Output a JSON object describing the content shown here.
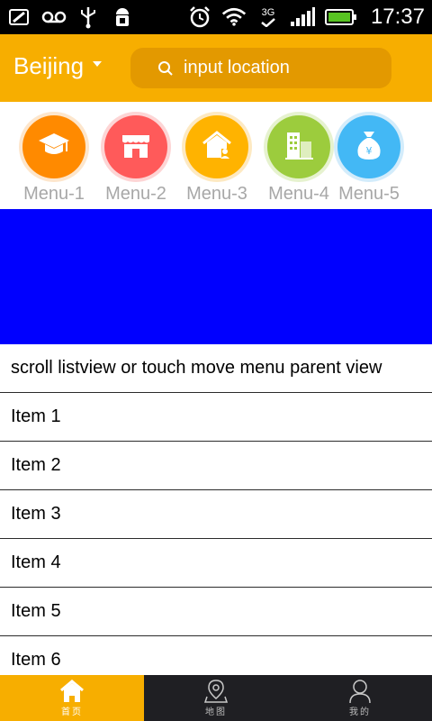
{
  "status_bar": {
    "time": "17:37",
    "network_label": "3G",
    "icons": [
      "sim-card-icon",
      "voicemail-icon",
      "usb-icon",
      "android-icon",
      "alarm-icon",
      "wifi-icon",
      "network-3g-icon",
      "signal-bars-icon",
      "battery-icon"
    ]
  },
  "header": {
    "city": "Beijing",
    "search_placeholder": "input location",
    "colors": {
      "bar": "#f7ae00",
      "search_bg": "#e39900"
    }
  },
  "menu": {
    "items": [
      {
        "label": "Menu-1",
        "icon": "graduation-cap-icon",
        "color": "#ff8a00",
        "ring": "#fde6cc"
      },
      {
        "label": "Menu-2",
        "icon": "shop-icon",
        "color": "#ff5a5a",
        "ring": "#fdd5d5"
      },
      {
        "label": "Menu-3",
        "icon": "home-person-icon",
        "color": "#ffb300",
        "ring": "#fde9c2"
      },
      {
        "label": "Menu-4",
        "icon": "buildings-icon",
        "color": "#9ccc3d",
        "ring": "#e6f2cf"
      },
      {
        "label": "Menu-5",
        "icon": "money-bag-icon",
        "color": "#43b8f5",
        "ring": "#d3ecfb"
      }
    ]
  },
  "banner": {
    "color": "#0000ff"
  },
  "list": {
    "rows": [
      "scroll listview or touch move menu parent view",
      "Item 1",
      "Item 2",
      "Item 3",
      "Item 4",
      "Item 5",
      "Item 6"
    ]
  },
  "bottom_nav": {
    "tabs": [
      {
        "label": "首页",
        "icon": "home-icon",
        "active": true
      },
      {
        "label": "地图",
        "icon": "map-pin-icon",
        "active": false
      },
      {
        "label": "我的",
        "icon": "profile-icon",
        "active": false
      }
    ]
  }
}
